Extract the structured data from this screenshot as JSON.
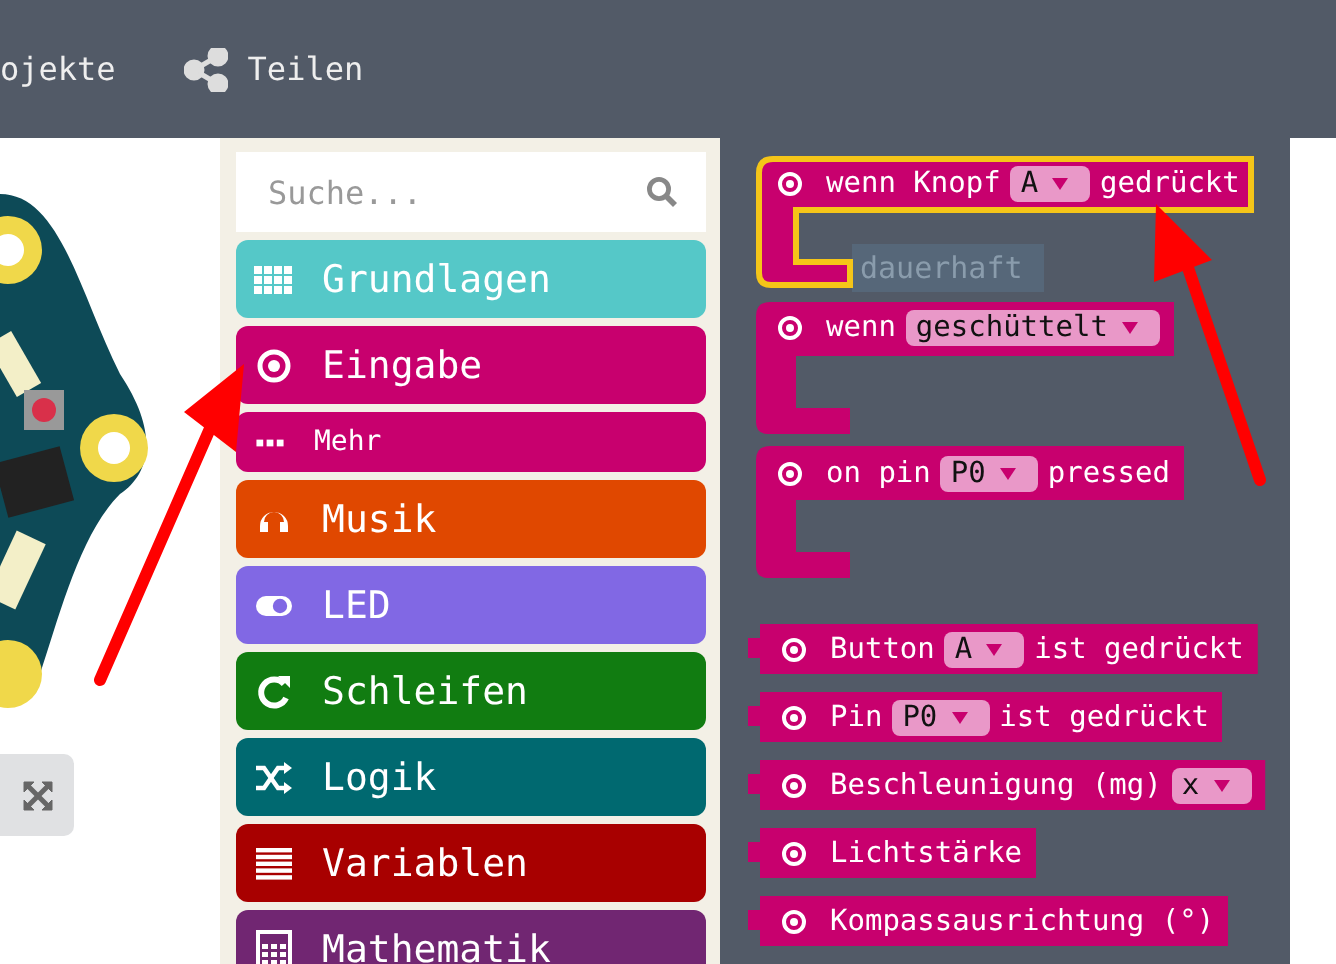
{
  "toolbar": {
    "projects_label": "ojekte",
    "share_button": "Teilen"
  },
  "search": {
    "placeholder": "Suche..."
  },
  "categories": [
    {
      "label": "Grundlagen",
      "color": "#55c8c8",
      "kind": "main"
    },
    {
      "label": "Eingabe",
      "color": "#c8006e",
      "kind": "main"
    },
    {
      "label": "Mehr",
      "color": "#c8006e",
      "kind": "sub"
    },
    {
      "label": "Musik",
      "color": "#e04800",
      "kind": "main"
    },
    {
      "label": "LED",
      "color": "#8168e4",
      "kind": "main"
    },
    {
      "label": "Schleifen",
      "color": "#117c11",
      "kind": "main"
    },
    {
      "label": "Logik",
      "color": "#006970",
      "kind": "main"
    },
    {
      "label": "Variablen",
      "color": "#a80000",
      "kind": "main"
    },
    {
      "label": "Mathematik",
      "color": "#712672",
      "kind": "main"
    }
  ],
  "workspace_block": {
    "label": "dauerhaft"
  },
  "blocks": [
    {
      "kind": "hat",
      "selected": true,
      "parts": [
        {
          "kind": "text",
          "text": "wenn Knopf"
        },
        {
          "kind": "dropdown",
          "text": "A"
        },
        {
          "kind": "text",
          "text": "gedrückt"
        }
      ]
    },
    {
      "kind": "hat",
      "selected": false,
      "parts": [
        {
          "kind": "text",
          "text": "wenn"
        },
        {
          "kind": "dropdown",
          "text": "geschüttelt"
        }
      ]
    },
    {
      "kind": "hat",
      "selected": false,
      "parts": [
        {
          "kind": "text",
          "text": "on pin"
        },
        {
          "kind": "dropdown",
          "text": "P0"
        },
        {
          "kind": "text",
          "text": "pressed"
        }
      ]
    },
    {
      "kind": "value",
      "selected": false,
      "parts": [
        {
          "kind": "text",
          "text": "Button"
        },
        {
          "kind": "dropdown",
          "text": "A"
        },
        {
          "kind": "text",
          "text": "ist gedrückt"
        }
      ]
    },
    {
      "kind": "value",
      "selected": false,
      "parts": [
        {
          "kind": "text",
          "text": "Pin"
        },
        {
          "kind": "dropdown",
          "text": "P0"
        },
        {
          "kind": "text",
          "text": "ist gedrückt"
        }
      ]
    },
    {
      "kind": "value",
      "selected": false,
      "parts": [
        {
          "kind": "text",
          "text": "Beschleunigung (mg)"
        },
        {
          "kind": "dropdown",
          "text": "x"
        }
      ]
    },
    {
      "kind": "value",
      "selected": false,
      "parts": [
        {
          "kind": "text",
          "text": "Lichtstärke"
        }
      ]
    },
    {
      "kind": "value",
      "selected": false,
      "parts": [
        {
          "kind": "text",
          "text": "Kompassausrichtung (°)"
        }
      ]
    }
  ]
}
